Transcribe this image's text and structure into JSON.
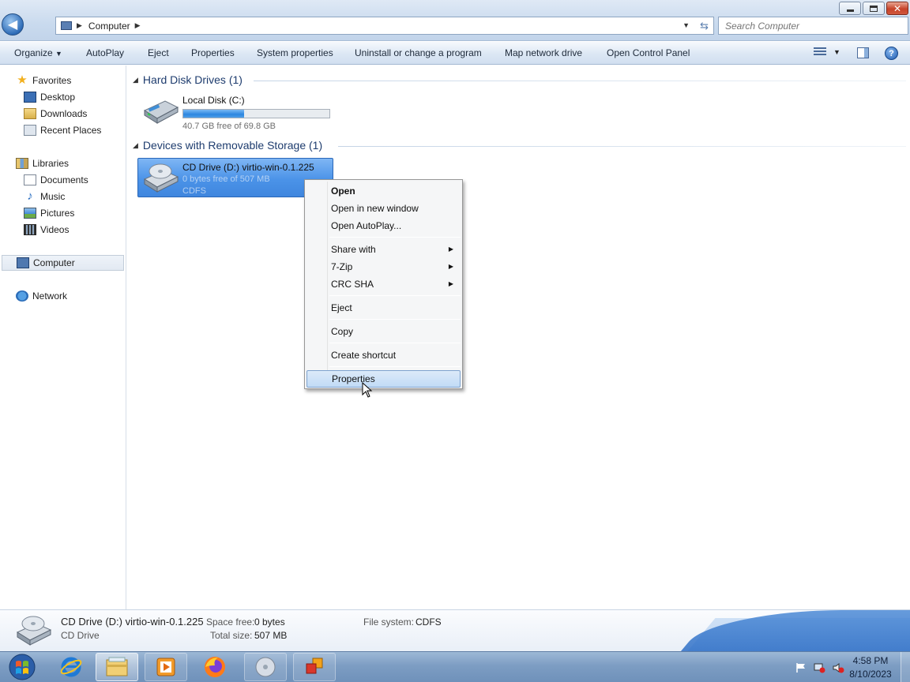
{
  "window": {
    "address_crumb": "Computer",
    "search_placeholder": "Search Computer"
  },
  "toolbar": {
    "organize": "Organize",
    "autoplay": "AutoPlay",
    "eject": "Eject",
    "properties": "Properties",
    "system_properties": "System properties",
    "uninstall": "Uninstall or change a program",
    "map_drive": "Map network drive",
    "control_panel": "Open Control Panel"
  },
  "nav": {
    "favorites": "Favorites",
    "desktop": "Desktop",
    "downloads": "Downloads",
    "recent": "Recent Places",
    "libraries": "Libraries",
    "documents": "Documents",
    "music": "Music",
    "pictures": "Pictures",
    "videos": "Videos",
    "computer": "Computer",
    "network": "Network"
  },
  "groups": {
    "hdd": "Hard Disk Drives (1)",
    "removable": "Devices with Removable Storage (1)"
  },
  "drives": {
    "c": {
      "name": "Local Disk (C:)",
      "free": "40.7 GB free of 69.8 GB",
      "used_fraction": 0.417
    },
    "d": {
      "name": "CD Drive (D:) virtio-win-0.1.225",
      "free": "0 bytes free of 507 MB",
      "fs": "CDFS"
    }
  },
  "context_menu": {
    "open": "Open",
    "open_new_window": "Open in new window",
    "open_autoplay": "Open AutoPlay...",
    "share_with": "Share with",
    "seven_zip": "7-Zip",
    "crc_sha": "CRC SHA",
    "eject": "Eject",
    "copy": "Copy",
    "create_shortcut": "Create shortcut",
    "properties": "Properties"
  },
  "details": {
    "name": "CD Drive (D:) virtio-win-0.1.225",
    "type": "CD Drive",
    "space_free_label": "Space free:",
    "space_free": "0 bytes",
    "total_size_label": "Total size:",
    "total_size": "507 MB",
    "fs_label": "File system:",
    "fs": "CDFS"
  },
  "taskbar": {
    "time": "4:58 PM",
    "date": "8/10/2023"
  }
}
